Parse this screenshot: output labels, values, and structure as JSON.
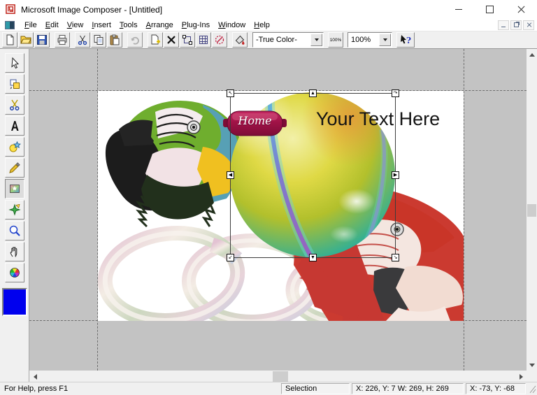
{
  "window": {
    "title": "Microsoft Image Composer - [Untitled]"
  },
  "menu": {
    "items": [
      "File",
      "Edit",
      "View",
      "Insert",
      "Tools",
      "Arrange",
      "Plug-Ins",
      "Window",
      "Help"
    ]
  },
  "toolbar": {
    "buttons": [
      "new",
      "open",
      "save",
      "print",
      "cut",
      "copy",
      "paste",
      "undo",
      "insert-image",
      "delete",
      "select-all",
      "grid-select",
      "clear-selection",
      "color-fill",
      "help-pointer"
    ],
    "color_format": "-True Color-",
    "actual_size_label": "100%",
    "zoom_level": "100%"
  },
  "toolbox": {
    "tools": [
      "select",
      "arrange",
      "cutout",
      "text",
      "shapes",
      "paint",
      "art-effects",
      "texture-transfer",
      "zoom",
      "pan",
      "color-picker"
    ],
    "current_color": "#0000ee"
  },
  "composition": {
    "text_sprite": "Your Text Here",
    "button_sprite_label": "Home",
    "sprites": [
      "blue-gold-macaw",
      "iridescent-rings",
      "rainbow-sphere",
      "home-button",
      "text",
      "red-macaw"
    ],
    "background_color": "#ffffff",
    "workspace_color": "#c3c3c3",
    "home_button_color": "#a01347"
  },
  "selection": {
    "handle_glyphs": [
      "↖",
      "▲",
      "↷",
      "◀",
      "▶",
      "↙",
      "▼",
      "↘"
    ]
  },
  "status": {
    "help_text": "For Help, press F1",
    "tool_mode": "Selection",
    "sprite_geometry": "X: 226, Y: 7  W: 269, H: 269",
    "cursor_position": "X: -73, Y: -68"
  }
}
